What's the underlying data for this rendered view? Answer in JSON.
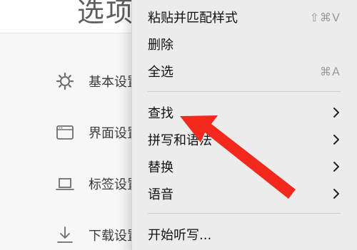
{
  "settings": {
    "title": "选项",
    "sidebar": {
      "items": [
        {
          "label": "基本设置",
          "icon": "gear-icon"
        },
        {
          "label": "界面设置",
          "icon": "window-icon"
        },
        {
          "label": "标签设置",
          "icon": "laptop-icon"
        },
        {
          "label": "下载设置",
          "icon": "download-icon"
        }
      ]
    }
  },
  "context_menu": {
    "items": [
      {
        "label": "粘贴并匹配样式",
        "shortcut": "⇧⌘V"
      },
      {
        "label": "删除"
      },
      {
        "label": "全选",
        "shortcut": "⌘A"
      },
      {
        "label": "查找",
        "submenu": true
      },
      {
        "label": "拼写和语法",
        "submenu": true
      },
      {
        "label": "替换",
        "submenu": true
      },
      {
        "label": "语音",
        "submenu": true
      },
      {
        "label": "开始听写..."
      }
    ]
  },
  "colors": {
    "menu_background": "#ececec",
    "sidebar_background": "#f7f7f8",
    "annotation_arrow": "#f2291c"
  }
}
